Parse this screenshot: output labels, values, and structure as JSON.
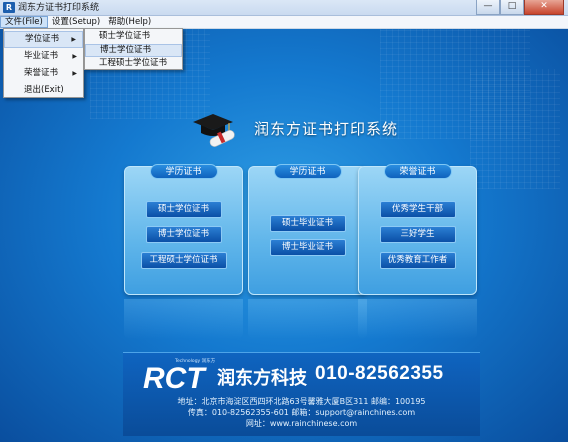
{
  "window": {
    "title": "润东方证书打印系统",
    "app_icon": "R",
    "controls": {
      "minimize": "—",
      "maximize": "□",
      "close": "✕"
    }
  },
  "menubar": [
    {
      "label": "文件(File)",
      "active": true
    },
    {
      "label": "设置(Setup)",
      "active": false
    },
    {
      "label": "帮助(Help)",
      "active": false
    }
  ],
  "file_menu": [
    {
      "label": "学位证书",
      "has_submenu": true
    },
    {
      "label": "毕业证书",
      "has_submenu": true
    },
    {
      "label": "荣誉证书",
      "has_submenu": true
    },
    {
      "label": "退出(Exit)",
      "has_submenu": false
    }
  ],
  "submenu_arrow": "▶",
  "degree_submenu": [
    {
      "label": "硕士学位证书"
    },
    {
      "label": "博士学位证书"
    },
    {
      "label": "工程硕士学位证书"
    }
  ],
  "main": {
    "app_title": "润东方证书打印系统",
    "panels": [
      {
        "header": "学历证书",
        "buttons": [
          "硕士学位证书",
          "博士学位证书",
          "工程硕士学位证书"
        ]
      },
      {
        "header": "学历证书",
        "buttons": [
          "硕士毕业证书",
          "博士毕业证书"
        ]
      },
      {
        "header": "荣誉证书",
        "buttons": [
          "优秀学生干部",
          "三好学生",
          "优秀教育工作者"
        ]
      }
    ]
  },
  "footer": {
    "logo_text": "RCT",
    "tech_tag": "Technology 润东方",
    "company": "润东方科技",
    "phone": "010-82562355",
    "address": "地址：北京市海淀区西四环北路63号馨雅大厦B区311    邮编：100195",
    "fax_email": "传真：010-82562355-601    邮箱：support@rainchines.com",
    "website": "网址：www.rainchinese.com"
  },
  "colors": {
    "stage_bg": "#1479cf",
    "panel_button": "#0a4fa6",
    "panel_header": "#0f62bd",
    "footer_bg": "#0a4c99"
  }
}
